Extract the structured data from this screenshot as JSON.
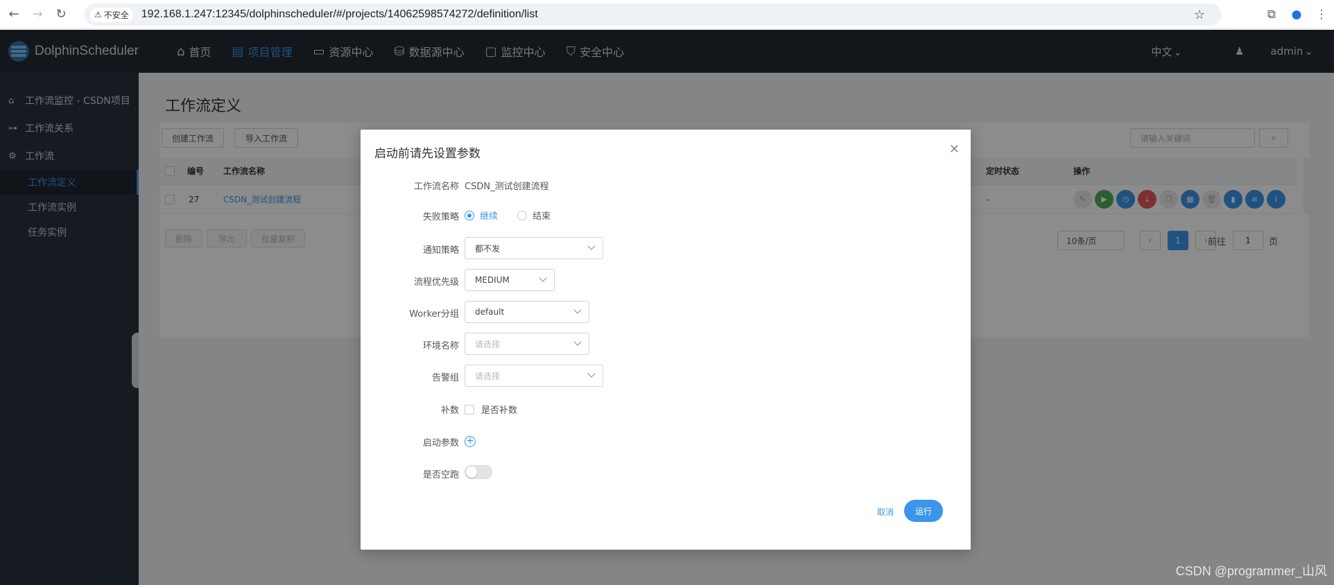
{
  "browser": {
    "insecure_label": "不安全",
    "url": "192.168.1.247:12345/dolphinscheduler/#/projects/14062598574272/definition/list"
  },
  "header": {
    "logo_text": "DolphinScheduler",
    "nav": [
      {
        "label": "首页",
        "icon": "home-icon"
      },
      {
        "label": "项目管理",
        "icon": "project-icon"
      },
      {
        "label": "资源中心",
        "icon": "folder-icon"
      },
      {
        "label": "数据源中心",
        "icon": "database-icon"
      },
      {
        "label": "监控中心",
        "icon": "monitor-icon"
      },
      {
        "label": "安全中心",
        "icon": "shield-icon"
      }
    ],
    "language": "中文",
    "user": "admin"
  },
  "sidebar": {
    "items": [
      {
        "label": "工作流监控 - CSDN项目",
        "icon": "home-icon"
      },
      {
        "label": "工作流关系",
        "icon": "relation-icon"
      },
      {
        "label": "工作流",
        "icon": "gear-icon"
      }
    ],
    "sub_items": [
      {
        "label": "工作流定义"
      },
      {
        "label": "工作流实例"
      },
      {
        "label": "任务实例"
      }
    ]
  },
  "page": {
    "title": "工作流定义",
    "create_button": "创建工作流",
    "import_button": "导入工作流",
    "search_placeholder": "请输入关键词",
    "table": {
      "headers": [
        "编号",
        "工作流名称",
        "定时状态",
        "操作"
      ],
      "rows": [
        {
          "id": "27",
          "name": "CSDN_测试创建流程",
          "schedule_status": "-"
        }
      ]
    },
    "bulk": {
      "delete": "删除",
      "export": "导出",
      "batch_copy": "批量复制"
    },
    "pagination": {
      "page_size": "10条/页",
      "current": "1",
      "goto_label": "前往",
      "goto_value": "1",
      "page_suffix": "页"
    }
  },
  "modal": {
    "title": "启动前请先设置参数",
    "fields": {
      "workflow_name_label": "工作流名称",
      "workflow_name": "CSDN_测试创建流程",
      "failure_strategy_label": "失败策略",
      "failure_options": [
        "继续",
        "结束"
      ],
      "notify_label": "通知策略",
      "notify_value": "都不发",
      "priority_label": "流程优先级",
      "priority_value": "MEDIUM",
      "worker_label": "Worker分组",
      "worker_value": "default",
      "env_label": "环境名称",
      "env_placeholder": "请选择",
      "alert_label": "告警组",
      "alert_placeholder": "请选择",
      "complement_label": "补数",
      "complement_check": "是否补数",
      "startup_params_label": "启动参数",
      "dry_run_label": "是否空跑"
    },
    "cancel": "取消",
    "run": "运行"
  },
  "watermark": "CSDN @programmer_山风",
  "colors": {
    "accent": "#3b95e9",
    "header_bg": "#242932",
    "sidebar_bg": "#29303d"
  }
}
